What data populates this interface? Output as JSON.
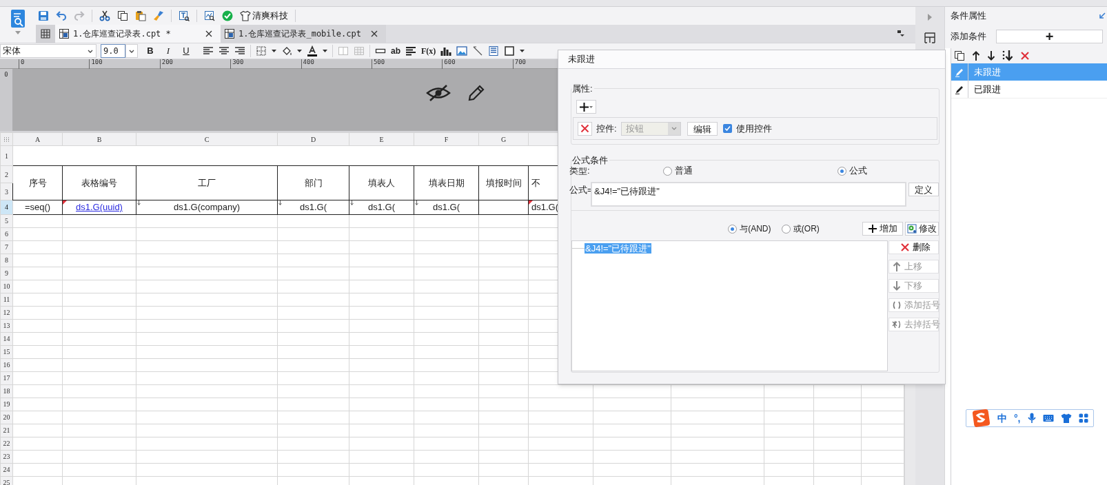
{
  "toolbar": {
    "brand_label": "清爽科技"
  },
  "tabs": [
    {
      "label": "1.仓库巡查记录表.cpt *",
      "selected": true
    },
    {
      "label": "1.仓库巡查记录表_mobile.cpt",
      "selected": false
    }
  ],
  "format_bar": {
    "font": "宋体",
    "size": "9.0",
    "style_buttons": [
      "B",
      "I",
      "U"
    ],
    "insert_labels": [
      "ab",
      "F(x)"
    ]
  },
  "ruler": {
    "labels": [
      "0",
      "100",
      "200",
      "300",
      "400",
      "500",
      "600",
      "700"
    ],
    "vertical_label": "0"
  },
  "sheet": {
    "columns": [
      "A",
      "B",
      "C",
      "D",
      "E",
      "F",
      "G"
    ],
    "row_numbers": [
      {
        "label": "1",
        "selected": false
      },
      {
        "label": "2",
        "selected": false
      },
      {
        "label": "3",
        "selected": false
      },
      {
        "label": "4",
        "selected": true
      },
      {
        "label": "5",
        "selected": false
      },
      {
        "label": "6",
        "selected": false
      },
      {
        "label": "7",
        "selected": false
      },
      {
        "label": "8",
        "selected": false
      },
      {
        "label": "9",
        "selected": false
      },
      {
        "label": "10",
        "selected": false
      },
      {
        "label": "11",
        "selected": false
      },
      {
        "label": "12",
        "selected": false
      },
      {
        "label": "13",
        "selected": false
      },
      {
        "label": "14",
        "selected": false
      },
      {
        "label": "15",
        "selected": false
      },
      {
        "label": "16",
        "selected": false
      },
      {
        "label": "17",
        "selected": false
      },
      {
        "label": "18",
        "selected": false
      },
      {
        "label": "19",
        "selected": false
      },
      {
        "label": "20",
        "selected": false
      },
      {
        "label": "21",
        "selected": false
      },
      {
        "label": "22",
        "selected": false
      },
      {
        "label": "23",
        "selected": false
      },
      {
        "label": "24",
        "selected": false
      },
      {
        "label": "25",
        "selected": false
      }
    ],
    "header_cells": [
      "序号",
      "表格编号",
      "工厂",
      "部门",
      "填表人",
      "填表日期",
      "填报时间",
      "不"
    ],
    "formula_cells": [
      {
        "text": "=seq()",
        "kind": "plain"
      },
      {
        "text": "ds1.G(uuid)",
        "kind": "link",
        "flag": true
      },
      {
        "text": "ds1.G(company)",
        "kind": "plain",
        "expand": true
      },
      {
        "text": "ds1.G(",
        "kind": "plain",
        "expand": true
      },
      {
        "text": "ds1.G(",
        "kind": "plain",
        "expand": true
      },
      {
        "text": "ds1.G(",
        "kind": "plain",
        "expand": true
      },
      {
        "kind": "empty"
      },
      {
        "text": "ds1.G(",
        "kind": "plain",
        "flag": true
      }
    ]
  },
  "dialog": {
    "title": "未跟进",
    "properties": {
      "label": "属性:",
      "control_label": "控件:",
      "control_value": "按钮",
      "control_disabled": true,
      "edit_button": "编辑",
      "use_control": {
        "label": "使用控件",
        "checked": true
      }
    },
    "formula_condition": {
      "label": "公式条件",
      "type_label": "类型:",
      "type_options": [
        {
          "label": "普通",
          "selected": false
        },
        {
          "label": "公式",
          "selected": true
        }
      ],
      "formula_label": "公式=",
      "formula_value": "&J4!=\"已待跟进\"",
      "define_button": "定义",
      "logic_options": [
        {
          "label": "与(AND)",
          "selected": true
        },
        {
          "label": "或(OR)",
          "selected": false
        }
      ],
      "add_button": "增加",
      "modify_button": "修改",
      "conditions": [
        {
          "text": "&J4!=\"已待跟进\"",
          "selected": true
        }
      ],
      "side_buttons": [
        {
          "label": "删除",
          "kind": "delete",
          "disabled": false
        },
        {
          "label": "上移",
          "kind": "up",
          "disabled": true
        },
        {
          "label": "下移",
          "kind": "down",
          "disabled": true
        },
        {
          "label": "添加括号",
          "kind": "add-paren",
          "disabled": true
        },
        {
          "label": "去掉括号",
          "kind": "remove-paren",
          "disabled": true
        }
      ]
    }
  },
  "right_panel": {
    "title": "条件属性",
    "add_label": "添加条件",
    "add_button": "+",
    "conditions": [
      {
        "label": "未跟进",
        "selected": true
      },
      {
        "label": "已跟进",
        "selected": false
      }
    ]
  },
  "ime": {
    "items": [
      "中",
      "°,"
    ]
  }
}
